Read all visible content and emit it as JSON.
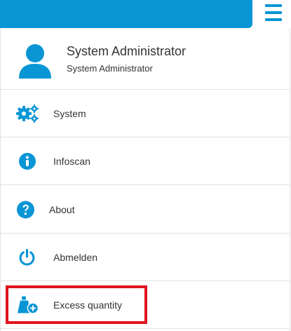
{
  "header": {
    "menu_icon": "hamburger-icon",
    "accent_color": "#0a95d5"
  },
  "profile": {
    "name": "System Administrator",
    "role": "System Administrator",
    "icon": "user-avatar-icon"
  },
  "menu": {
    "items": [
      {
        "label": "System",
        "icon": "gears-icon"
      },
      {
        "label": "Infoscan",
        "icon": "info-icon"
      },
      {
        "label": "About",
        "icon": "question-icon"
      },
      {
        "label": "Abmelden",
        "icon": "power-icon"
      },
      {
        "label": "Excess quantity",
        "icon": "weight-add-icon"
      }
    ]
  },
  "highlight_color": "#e0141e"
}
